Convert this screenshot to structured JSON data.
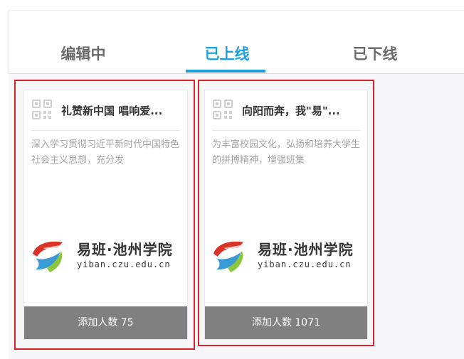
{
  "tabs": [
    {
      "label": "编辑中"
    },
    {
      "label": "已上线"
    },
    {
      "label": "已下线"
    }
  ],
  "active_tab": "已上线",
  "accent_color": "#1e9fe0",
  "highlight_color": "#d9242b",
  "cards": [
    {
      "title": "礼赞新中国 唱响爱...",
      "description": "深入学习贯彻习近平新时代中国特色社会主义思想，充分发",
      "logo_name": "易班·池州学院",
      "logo_url": "yiban.czu.edu.cn",
      "count_label": "添加人数 75",
      "icon": "qr-code-icon"
    },
    {
      "title": "向阳而奔，我\"易\"...",
      "description": "为丰富校园文化，弘扬和培养大学生的拼搏精神，增强班集",
      "logo_name": "易班·池州学院",
      "logo_url": "yiban.czu.edu.cn",
      "count_label": "添加人数 1071",
      "icon": "qr-code-icon"
    }
  ]
}
